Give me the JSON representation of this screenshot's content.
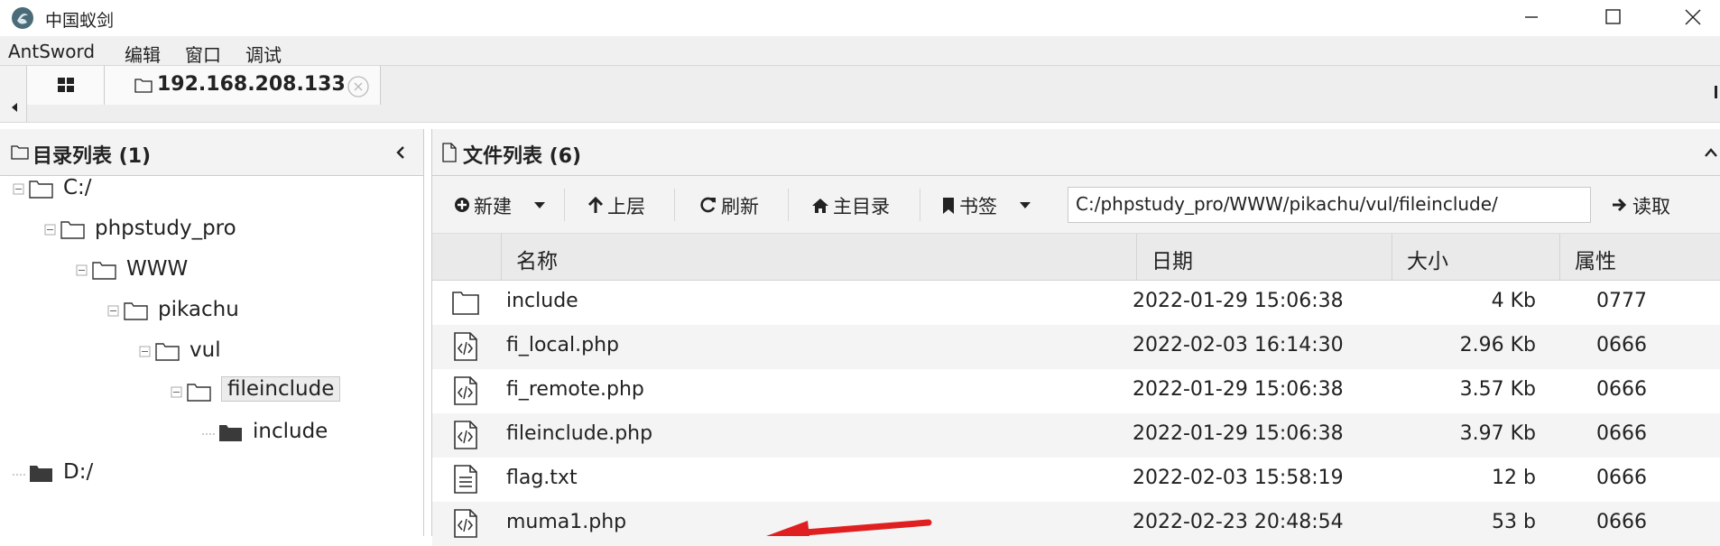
{
  "window": {
    "title": "中国蚁剑"
  },
  "menu": {
    "items": [
      "AntSword",
      "编辑",
      "窗口",
      "调试"
    ]
  },
  "tabs": [
    {
      "label": "192.168.208.133"
    }
  ],
  "dir_panel": {
    "title": "目录列表 (1)",
    "tree": [
      {
        "label": "C:/",
        "level": 0,
        "type": "folder-open"
      },
      {
        "label": "phpstudy_pro",
        "level": 1,
        "type": "folder-open"
      },
      {
        "label": "WWW",
        "level": 2,
        "type": "folder-open"
      },
      {
        "label": "pikachu",
        "level": 3,
        "type": "folder-open"
      },
      {
        "label": "vul",
        "level": 4,
        "type": "folder-open"
      },
      {
        "label": "fileinclude",
        "level": 5,
        "type": "folder-open",
        "selected": true
      },
      {
        "label": "include",
        "level": 6,
        "type": "folder-filled"
      },
      {
        "label": "D:/",
        "level": 0,
        "type": "folder-filled"
      }
    ]
  },
  "file_panel": {
    "title": "文件列表 (6)",
    "toolbar": {
      "new_label": "新建",
      "up_label": "上层",
      "refresh_label": "刷新",
      "home_label": "主目录",
      "bookmark_label": "书签",
      "path_value": "C:/phpstudy_pro/WWW/pikachu/vul/fileinclude/",
      "read_label": "读取"
    },
    "columns": [
      "名称",
      "日期",
      "大小",
      "属性"
    ],
    "rows": [
      {
        "icon": "folder-icon",
        "name": "include",
        "date": "2022-01-29 15:06:38",
        "size": "4 Kb",
        "attr": "0777"
      },
      {
        "icon": "code-file-icon",
        "name": "fi_local.php",
        "date": "2022-02-03 16:14:30",
        "size": "2.96 Kb",
        "attr": "0666"
      },
      {
        "icon": "code-file-icon",
        "name": "fi_remote.php",
        "date": "2022-01-29 15:06:38",
        "size": "3.57 Kb",
        "attr": "0666"
      },
      {
        "icon": "code-file-icon",
        "name": "fileinclude.php",
        "date": "2022-01-29 15:06:38",
        "size": "3.97 Kb",
        "attr": "0666"
      },
      {
        "icon": "text-file-icon",
        "name": "flag.txt",
        "date": "2022-02-03 15:58:19",
        "size": "12 b",
        "attr": "0666"
      },
      {
        "icon": "code-file-icon",
        "name": "muma1.php",
        "date": "2022-02-23 20:48:54",
        "size": "53 b",
        "attr": "0666"
      }
    ]
  },
  "colors": {
    "annotation_arrow": "#e02020",
    "selection": "#ececec"
  }
}
